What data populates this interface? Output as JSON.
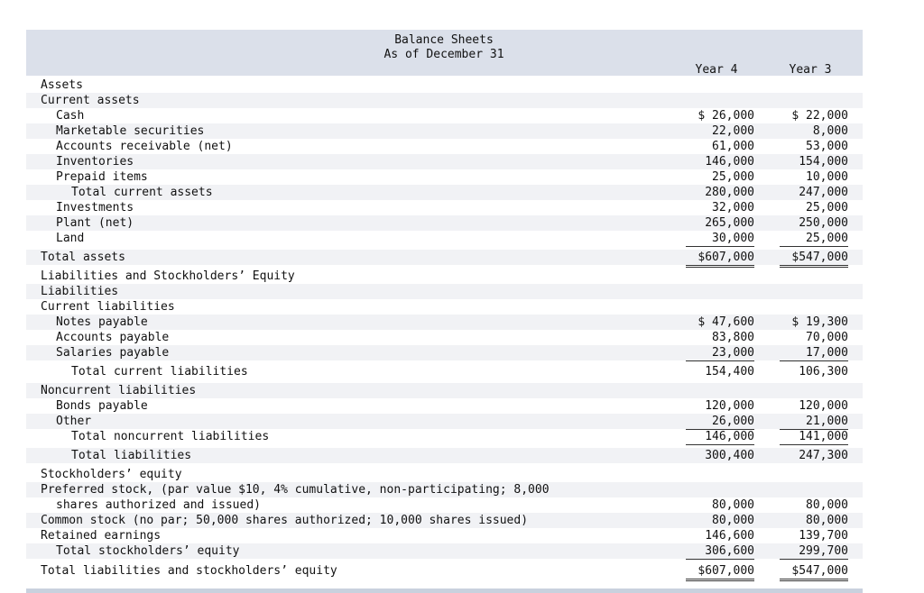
{
  "header": {
    "title": "Balance Sheets",
    "subtitle": "As of December 31",
    "col_year4": "Year 4",
    "col_year3": "Year 3"
  },
  "rows": [
    {
      "label": "Assets",
      "indent": 0,
      "y4": "",
      "y3": ""
    },
    {
      "label": "Current assets",
      "indent": 0,
      "y4": "",
      "y3": ""
    },
    {
      "label": "Cash",
      "indent": 1,
      "y4": "$ 26,000",
      "y3": "$ 22,000"
    },
    {
      "label": "Marketable securities",
      "indent": 1,
      "y4": "22,000",
      "y3": "8,000"
    },
    {
      "label": "Accounts receivable (net)",
      "indent": 1,
      "y4": "61,000",
      "y3": "53,000"
    },
    {
      "label": "Inventories",
      "indent": 1,
      "y4": "146,000",
      "y3": "154,000"
    },
    {
      "label": "Prepaid items",
      "indent": 1,
      "y4": "25,000",
      "y3": "10,000"
    },
    {
      "label": "Total current assets",
      "indent": 2,
      "y4": "280,000",
      "y3": "247,000"
    },
    {
      "label": "Investments",
      "indent": 1,
      "y4": "32,000",
      "y3": "25,000"
    },
    {
      "label": "Plant (net)",
      "indent": 1,
      "y4": "265,000",
      "y3": "250,000"
    },
    {
      "label": "Land",
      "indent": 1,
      "y4": "30,000",
      "y3": "25,000"
    },
    {
      "label": "Total assets",
      "indent": 0,
      "y4": "$607,000",
      "y3": "$547,000"
    },
    {
      "label": "Liabilities and Stockholders’ Equity",
      "indent": 0,
      "y4": "",
      "y3": ""
    },
    {
      "label": "Liabilities",
      "indent": 0,
      "y4": "",
      "y3": ""
    },
    {
      "label": "Current liabilities",
      "indent": 0,
      "y4": "",
      "y3": ""
    },
    {
      "label": "Notes payable",
      "indent": 1,
      "y4": "$ 47,600",
      "y3": "$ 19,300"
    },
    {
      "label": "Accounts payable",
      "indent": 1,
      "y4": "83,800",
      "y3": "70,000"
    },
    {
      "label": "Salaries payable",
      "indent": 1,
      "y4": "23,000",
      "y3": "17,000"
    },
    {
      "label": "Total current liabilities",
      "indent": 2,
      "y4": "154,400",
      "y3": "106,300"
    },
    {
      "label": "Noncurrent liabilities",
      "indent": 0,
      "y4": "",
      "y3": ""
    },
    {
      "label": "Bonds payable",
      "indent": 1,
      "y4": "120,000",
      "y3": "120,000"
    },
    {
      "label": "Other",
      "indent": 1,
      "y4": "26,000",
      "y3": "21,000"
    },
    {
      "label": "Total noncurrent liabilities",
      "indent": 2,
      "y4": "146,000",
      "y3": "141,000"
    },
    {
      "label": "Total liabilities",
      "indent": 2,
      "y4": "300,400",
      "y3": "247,300"
    },
    {
      "label": "Stockholders’ equity",
      "indent": 0,
      "y4": "",
      "y3": ""
    },
    {
      "label": "Preferred stock, (par value $10, 4% cumulative, non-participating; 8,000",
      "indent": 0,
      "y4": "",
      "y3": ""
    },
    {
      "label": "shares authorized and issued)",
      "indent": 1,
      "y4": "80,000",
      "y3": "80,000"
    },
    {
      "label": "Common stock (no par; 50,000 shares authorized; 10,000 shares issued)",
      "indent": 0,
      "y4": "80,000",
      "y3": "80,000"
    },
    {
      "label": "Retained earnings",
      "indent": 0,
      "y4": "146,600",
      "y3": "139,700"
    },
    {
      "label": "Total stockholders’ equity",
      "indent": 1,
      "y4": "306,600",
      "y3": "299,700"
    },
    {
      "label": "Total liabilities and stockholders’ equity",
      "indent": 0,
      "y4": "$607,000",
      "y3": "$547,000"
    }
  ]
}
